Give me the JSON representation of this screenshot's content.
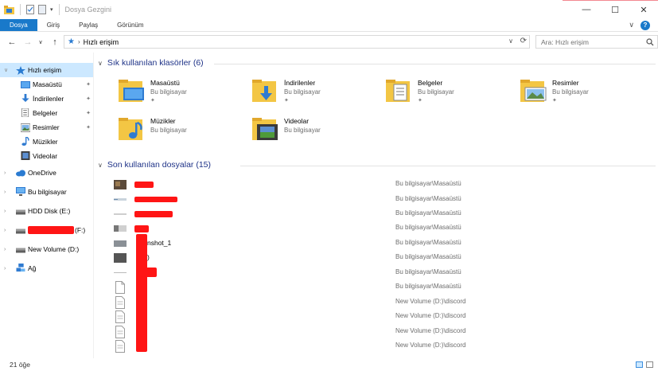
{
  "window": {
    "title": "Dosya Gezgini",
    "minimize_glyph": "—",
    "maximize_glyph": "☐",
    "close_glyph": "✕"
  },
  "ribbon": {
    "tabs": [
      {
        "label": "Dosya",
        "active": true
      },
      {
        "label": "Giriş",
        "active": false
      },
      {
        "label": "Paylaş",
        "active": false
      },
      {
        "label": "Görünüm",
        "active": false
      }
    ],
    "expand_glyph": "∨",
    "help_glyph": "?"
  },
  "nav": {
    "back_glyph": "←",
    "forward_glyph": "→",
    "recent_glyph": "∨",
    "up_glyph": "↑"
  },
  "address": {
    "location": "Hızlı erişim",
    "separator_glyph": "›",
    "dropdown_glyph": "∨",
    "refresh_glyph": "⟳"
  },
  "search": {
    "placeholder": "Ara: Hızlı erişim",
    "icon": "search-icon"
  },
  "sidebar": {
    "items": [
      {
        "label": "Hızlı erişim",
        "icon": "star-icon",
        "expand": "∨",
        "selected": true,
        "pinned": false,
        "level": 0
      },
      {
        "label": "Masaüstü",
        "icon": "desktop-icon",
        "expand": "",
        "selected": false,
        "pinned": true,
        "level": 1
      },
      {
        "label": "İndirilenler",
        "icon": "download-icon",
        "expand": "",
        "selected": false,
        "pinned": true,
        "level": 1
      },
      {
        "label": "Belgeler",
        "icon": "documents-icon",
        "expand": "",
        "selected": false,
        "pinned": true,
        "level": 1
      },
      {
        "label": "Resimler",
        "icon": "pictures-icon",
        "expand": "",
        "selected": false,
        "pinned": true,
        "level": 1
      },
      {
        "label": "Müzikler",
        "icon": "music-icon",
        "expand": "",
        "selected": false,
        "pinned": false,
        "level": 1
      },
      {
        "label": "Videolar",
        "icon": "videos-icon",
        "expand": "",
        "selected": false,
        "pinned": false,
        "level": 1
      },
      {
        "label": "OneDrive",
        "icon": "cloud-icon",
        "expand": "›",
        "selected": false,
        "pinned": false,
        "level": 0
      },
      {
        "label": "Bu bilgisayar",
        "icon": "computer-icon",
        "expand": "›",
        "selected": false,
        "pinned": false,
        "level": 0
      },
      {
        "label": "HDD Disk (E:)",
        "icon": "drive-icon",
        "expand": "›",
        "selected": false,
        "pinned": false,
        "level": 0
      },
      {
        "label": "(F:)",
        "icon": "drive-icon",
        "expand": "›",
        "selected": false,
        "pinned": false,
        "level": 0
      },
      {
        "label": "New Volume (D:)",
        "icon": "drive-icon",
        "expand": "›",
        "selected": false,
        "pinned": false,
        "level": 0
      },
      {
        "label": "Ağ",
        "icon": "network-icon",
        "expand": "›",
        "selected": false,
        "pinned": false,
        "level": 0
      }
    ],
    "pin_glyph": "📌"
  },
  "frequent": {
    "title": "Sık kullanılan klasörler (6)",
    "chevron": "∨",
    "folders": [
      {
        "name": "Masaüstü",
        "location": "Bu bilgisayar",
        "icon": "desktop-folder-icon",
        "pinned": true
      },
      {
        "name": "İndirilenler",
        "location": "Bu bilgisayar",
        "icon": "downloads-folder-icon",
        "pinned": true
      },
      {
        "name": "Belgeler",
        "location": "Bu bilgisayar",
        "icon": "documents-folder-icon",
        "pinned": true
      },
      {
        "name": "Resimler",
        "location": "Bu bilgisayar",
        "icon": "pictures-folder-icon",
        "pinned": true
      },
      {
        "name": "Müzikler",
        "location": "Bu bilgisayar",
        "icon": "music-folder-icon",
        "pinned": false
      },
      {
        "name": "Videolar",
        "location": "Bu bilgisayar",
        "icon": "videos-folder-icon",
        "pinned": false
      }
    ]
  },
  "recent": {
    "title": "Son kullanılan dosyalar (15)",
    "chevron": "∨",
    "files": [
      {
        "name": "",
        "path": "Bu bilgisayar\\Masaüstü",
        "icon": "image-file-icon"
      },
      {
        "name": "",
        "path": "Bu bilgisayar\\Masaüstü",
        "icon": "image-file-icon"
      },
      {
        "name": "",
        "path": "Bu bilgisayar\\Masaüstü",
        "icon": "image-file-icon"
      },
      {
        "name": "",
        "path": "Bu bilgisayar\\Masaüstü",
        "icon": "image-file-icon"
      },
      {
        "name": "nshot_1",
        "path": "Bu bilgisayar\\Masaüstü",
        "icon": "image-file-icon"
      },
      {
        "name": ")",
        "path": "Bu bilgisayar\\Masaüstü",
        "icon": "image-file-icon"
      },
      {
        "name": "",
        "path": "Bu bilgisayar\\Masaüstü",
        "icon": "image-file-icon"
      },
      {
        "name": "",
        "path": "Bu bilgisayar\\Masaüstü",
        "icon": "document-file-icon"
      },
      {
        "name": "",
        "path": "New Volume (D:)\\discord",
        "icon": "document-file-icon"
      },
      {
        "name": "",
        "path": "New Volume (D:)\\discord",
        "icon": "document-file-icon"
      },
      {
        "name": "",
        "path": "New Volume (D:)\\discord",
        "icon": "document-file-icon"
      },
      {
        "name": "",
        "path": "New Volume (D:)\\discord",
        "icon": "document-file-icon"
      }
    ]
  },
  "status": {
    "item_count": "21 öğe"
  },
  "colors": {
    "accent": "#1979ca",
    "selection": "#cce8ff",
    "section_title": "#1e3287",
    "redaction": "#ff1515"
  }
}
